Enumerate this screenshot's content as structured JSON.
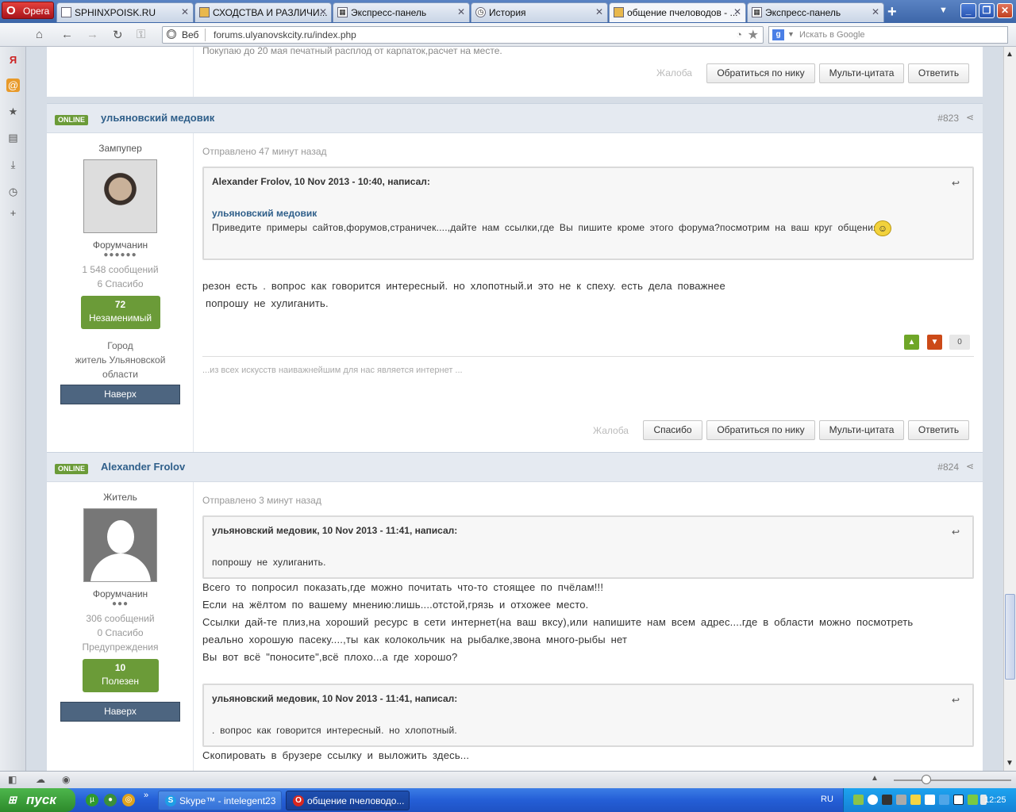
{
  "browser": {
    "menu_label": "Opera",
    "tabs": [
      {
        "label": "SPHINXPOISK.RU",
        "icon": "page-icon"
      },
      {
        "label": "СХОДСТВА И РАЗЛИЧИ...",
        "icon": "bee-icon"
      },
      {
        "label": "Экспресс-панель",
        "icon": "grid-icon"
      },
      {
        "label": "История",
        "icon": "clock-icon"
      },
      {
        "label": "общение пчеловодов - ...",
        "icon": "bee-icon",
        "active": true
      },
      {
        "label": "Экспресс-панель",
        "icon": "grid-icon"
      }
    ],
    "address": {
      "security_label": "Веб",
      "url": "forums.ulyanovskcity.ru/index.php"
    },
    "search_placeholder": "Искать в Google",
    "search_engine": "g"
  },
  "forum": {
    "prev_post": {
      "text": "Покупаю до 20 мая печатный расплод от карпаток,расчет на месте.",
      "actions": [
        "Жалоба",
        "Обратиться по нику",
        "Мульти-цитата",
        "Ответить"
      ]
    },
    "posts": [
      {
        "status": "ONLINE",
        "author": "ульяновский медовик",
        "number": "#823",
        "user_title": "Зампупер",
        "rank": "Форумчанин",
        "pips": "●●●●●●",
        "posts_count": "1 548 сообщений",
        "thanks": "6 Спасибо",
        "reputation_value": "72",
        "reputation_label": "Незаменимый",
        "city_label": "Город",
        "city_value": "житель Ульяновской области",
        "top_label": "Наверх",
        "sent": "Отправлено 47 минут назад",
        "quote": {
          "header": "Alexander Frolov, 10 Nov 2013 - 10:40, написал:",
          "name": "ульяновский медовик",
          "text": "Приведите примеры сайтов,форумов,страничек....,дайте нам ссылки,где Вы пишите кроме этого форума?посмотрим на ваш круг общения"
        },
        "lines": [
          " резон есть . вопрос как говорится интересный. но хлопотный.и это не к спеху. есть дела поважнее",
          "попрошу не хулиганить."
        ],
        "vote_count": "0",
        "signature": "...из всех искусств наиважнейшим для нас является интернет ...",
        "actions": [
          "Жалоба",
          "Спасибо",
          "Обратиться по нику",
          "Мульти-цитата",
          "Ответить"
        ]
      },
      {
        "status": "ONLINE",
        "author": "Alexander Frolov",
        "number": "#824",
        "user_title": "Житель",
        "rank": "Форумчанин",
        "pips": "●●●",
        "posts_count": "306 сообщений",
        "thanks": "0 Спасибо",
        "warnings": "Предупреждения",
        "reputation_value": "10",
        "reputation_label": "Полезен",
        "top_label": "Наверх",
        "sent": "Отправлено 3 минут назад",
        "quote1": {
          "header": "ульяновский медовик, 10 Nov 2013 - 11:41, написал:",
          "text": " попрошу не хулиганить."
        },
        "lines": [
          "Всего то попросил показать,где можно почитать что-то стоящее по пчёлам!!!",
          "Если на жёлтом по вашему мнению:лишь....отстой,грязь и отхожее место.",
          "Ссылки дай-те плиз,на хороший ресурс в сети интернет(на ваш вксу),или напишите нам всем адрес....где в области можно посмотреть",
          "реально хорошую пасеку....,ты как колокольчик на рыбалке,звона много-рыбы нет",
          "Вы вот всё \"поносите\",всё плохо...а где хорошо?"
        ],
        "quote2": {
          "header": "ульяновский медовик, 10 Nov 2013 - 11:41, написал:",
          "text": ". вопрос как говорится интересный. но хлопотный."
        },
        "tail_line": "Скопировать в брузере ссылку и выложить здесь..."
      }
    ]
  },
  "taskbar": {
    "start_label": "пуск",
    "tasks": [
      {
        "label": "Skype™ - intelegent23",
        "icon": "skype-icon"
      },
      {
        "label": "общение пчеловодо...",
        "icon": "opera-icon"
      }
    ],
    "language": "RU",
    "clock": "12:25"
  }
}
